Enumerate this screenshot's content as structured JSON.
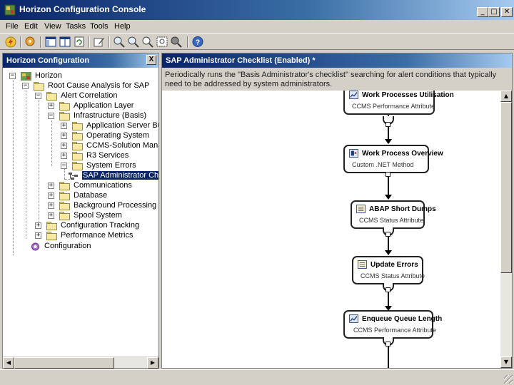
{
  "window": {
    "title": "Horizon Configuration Console",
    "minimize": "_",
    "maximize": "□",
    "close": "✕"
  },
  "menu": [
    "File",
    "Edit",
    "View",
    "Tasks",
    "Tools",
    "Help"
  ],
  "toolbar_icons": [
    "lightning-icon",
    "star-icon",
    "panel-icon",
    "panel-split-icon",
    "refresh-icon",
    "edit-icon",
    "zoom-in-icon",
    "zoom-out-icon",
    "zoom-icon",
    "fit-icon",
    "zoom-area-icon",
    "help-icon"
  ],
  "left_pane": {
    "title": "Horizon Configuration",
    "close": "X",
    "tree": [
      {
        "label": "Horizon",
        "expander": "−"
      },
      {
        "label": "Root Cause Analysis for SAP",
        "expander": "−"
      },
      {
        "label": "Alert Correlation",
        "expander": "−"
      },
      {
        "label": "Application Layer",
        "expander": "+"
      },
      {
        "label": "Infrastructure (Basis)",
        "expander": "−"
      },
      {
        "label": "Application Server Buffers",
        "expander": "+"
      },
      {
        "label": "Operating System",
        "expander": "+"
      },
      {
        "label": "CCMS-Solution Manager",
        "expander": "+"
      },
      {
        "label": "R3 Services",
        "expander": "+"
      },
      {
        "label": "System Errors",
        "expander": "−"
      },
      {
        "label": "SAP Administrator Checklist",
        "expander": ""
      },
      {
        "label": "Communications",
        "expander": "+"
      },
      {
        "label": "Database",
        "expander": "+"
      },
      {
        "label": "Background Processing",
        "expander": "+"
      },
      {
        "label": "Spool System",
        "expander": "+"
      },
      {
        "label": "Configuration Tracking",
        "expander": "+"
      },
      {
        "label": "Performance Metrics",
        "expander": "+"
      },
      {
        "label": "Configuration",
        "expander": ""
      }
    ]
  },
  "right_pane": {
    "title": "SAP Administrator Checklist (Enabled) *",
    "description": "Periodically runs the \"Basis Administrator's checklist\" searching for alert conditions that typically need to be addressed by system administrators.",
    "nodes": [
      {
        "title": "Work Processes Utilisation",
        "subtitle": "CCMS Performance Attribute",
        "icon": "chart-icon"
      },
      {
        "title": "Work Process Overview",
        "subtitle": "Custom .NET Method",
        "icon": "code-icon"
      },
      {
        "title": "ABAP Short Dumps",
        "subtitle": "CCMS Status Attribute",
        "icon": "list-icon"
      },
      {
        "title": "Update Errors",
        "subtitle": "CCMS Status Attribute",
        "icon": "list-icon"
      },
      {
        "title": "Enqueue Queue Length",
        "subtitle": "CCMS Performance Attribute",
        "icon": "chart-icon"
      }
    ]
  }
}
